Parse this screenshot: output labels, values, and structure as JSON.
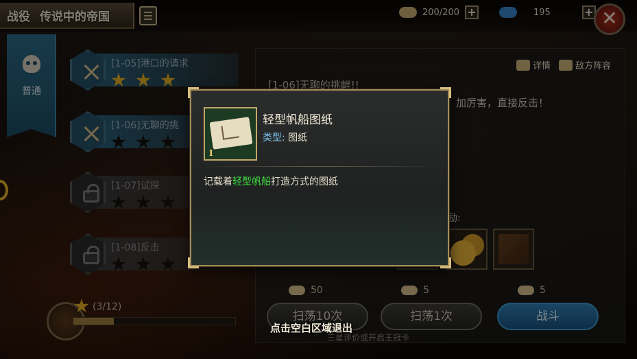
{
  "header": {
    "title": "战役",
    "subtitle": "传说中的帝国",
    "resources": [
      {
        "icon": "ration-icon",
        "value": "200/200"
      },
      {
        "icon": "gem-icon",
        "value": "195"
      }
    ],
    "plus_label": "+",
    "close_label": "✕"
  },
  "left_tab": {
    "label": "普通",
    "icon": "skull-crossbones-icon"
  },
  "levels": [
    {
      "name": "[1-05]港口的请求",
      "stars": 3,
      "locked": false
    },
    {
      "name": "[1-06]无聊的挑",
      "stars": 0,
      "locked": false
    },
    {
      "name": "[1-07]试探",
      "stars": 0,
      "locked": true
    },
    {
      "name": "[1-08]反击",
      "stars": 0,
      "locked": true
    }
  ],
  "progress": {
    "text": "(3/12)",
    "fraction": 0.25
  },
  "panel": {
    "detail_label": "详情",
    "enemy_label": "敌方阵容",
    "stage_title": "[1-06]无聊的挑衅!!",
    "stage_desc": "加厉害，直接反击！",
    "reward_label": "励:",
    "costs": [
      "50",
      "5",
      "5"
    ],
    "buttons": {
      "sweep10": "扫荡10次",
      "sweep1": "扫荡1次",
      "battle": "战斗"
    },
    "crown_hint": "三星评价或开启王冠卡"
  },
  "tooltip": {
    "item_name": "轻型帆船图纸",
    "type_label": "类型:",
    "type_value": " 图纸",
    "tier": "I",
    "desc_prefix": "记载着",
    "desc_highlight": "轻型帆船",
    "desc_suffix": "打造方式的图纸"
  },
  "exit_hint": "点击空白区域退出",
  "colors": {
    "highlight": "#3fe03f",
    "type_label": "#7fc3ef",
    "star_gold": "#e6b024",
    "battle_blue": "#2f7fb5"
  }
}
